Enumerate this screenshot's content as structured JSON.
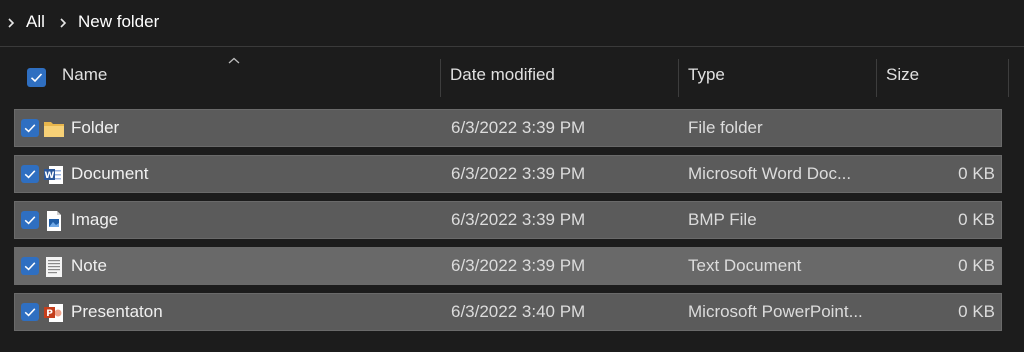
{
  "breadcrumb": {
    "items": [
      "All",
      "New folder"
    ]
  },
  "columns": {
    "name": "Name",
    "date": "Date modified",
    "type": "Type",
    "size": "Size"
  },
  "files": [
    {
      "name": "Folder",
      "date": "6/3/2022 3:39 PM",
      "type": "File folder",
      "size": "",
      "icon": "folder-icon",
      "selected": true
    },
    {
      "name": "Document",
      "date": "6/3/2022 3:39 PM",
      "type": "Microsoft Word Doc...",
      "size": "0 KB",
      "icon": "word-document-icon",
      "selected": true
    },
    {
      "name": "Image",
      "date": "6/3/2022 3:39 PM",
      "type": "BMP File",
      "size": "0 KB",
      "icon": "image-file-icon",
      "selected": true
    },
    {
      "name": "Note",
      "date": "6/3/2022 3:39 PM",
      "type": "Text Document",
      "size": "0 KB",
      "icon": "text-document-icon",
      "selected": true
    },
    {
      "name": "Presentaton",
      "date": "6/3/2022 3:40 PM",
      "type": "Microsoft PowerPoint...",
      "size": "0 KB",
      "icon": "powerpoint-icon",
      "selected": true
    }
  ],
  "colors": {
    "accent": "#2f6fc1",
    "background": "#1c1c1c",
    "row_selected": "#5b5b5b"
  }
}
